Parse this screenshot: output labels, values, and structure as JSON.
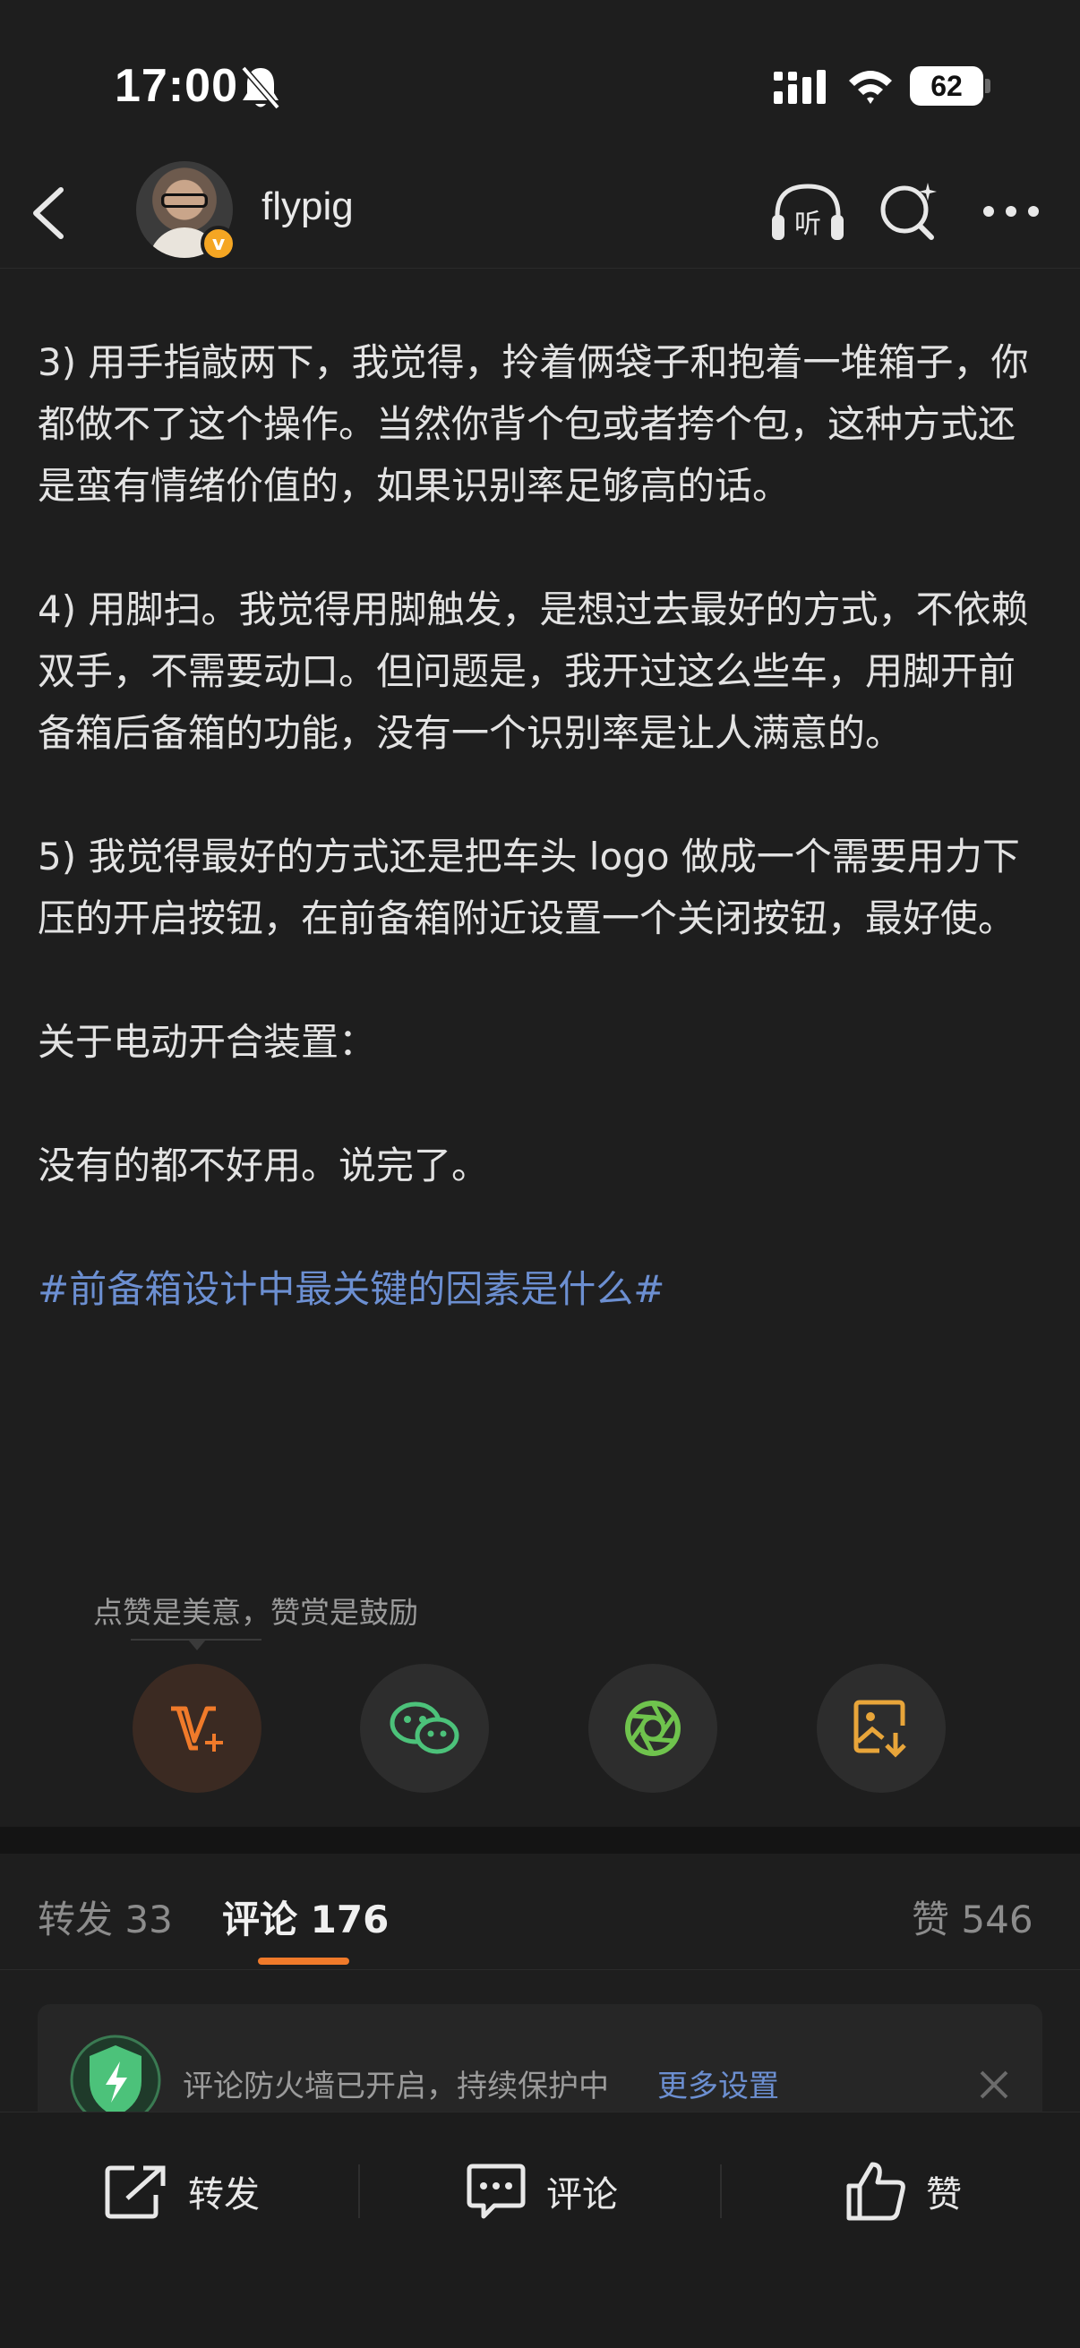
{
  "status_bar": {
    "time": "17:00",
    "battery": "62"
  },
  "header": {
    "username": "flypig"
  },
  "post": {
    "paragraphs": [
      "3) 用手指敲两下，我觉得，拎着俩袋子和抱着一堆箱子，你都做不了这个操作。当然你背个包或者挎个包，这种方式还是蛮有情绪价值的，如果识别率足够高的话。",
      "4) 用脚扫。我觉得用脚触发，是想过去最好的方式，不依赖双手，不需要动口。但问题是，我开过这么些车，用脚开前备箱后备箱的功能，没有一个识别率是让人满意的。",
      "5) 我觉得最好的方式还是把车头 logo 做成一个需要用力下压的开启按钮，在前备箱附近设置一个关闭按钮，最好使。",
      "关于电动开合装置：",
      "没有的都不好用。说完了。"
    ],
    "hashtag": "#前备箱设计中最关键的因素是什么#"
  },
  "reward": {
    "hint": "点赞是美意，赞赏是鼓励"
  },
  "tabs": {
    "repost_label": "转发",
    "repost_count": "33",
    "comment_label": "评论",
    "comment_count": "176",
    "like_label": "赞",
    "like_count": "546"
  },
  "notice": {
    "text": "评论防火墙已开启，持续保护中",
    "link": "更多设置"
  },
  "bottom_bar": {
    "repost": "转发",
    "comment": "评论",
    "like": "赞"
  },
  "colors": {
    "accent": "#f07a2a",
    "link": "#6c8fd1",
    "background": "#1e1e1e"
  }
}
